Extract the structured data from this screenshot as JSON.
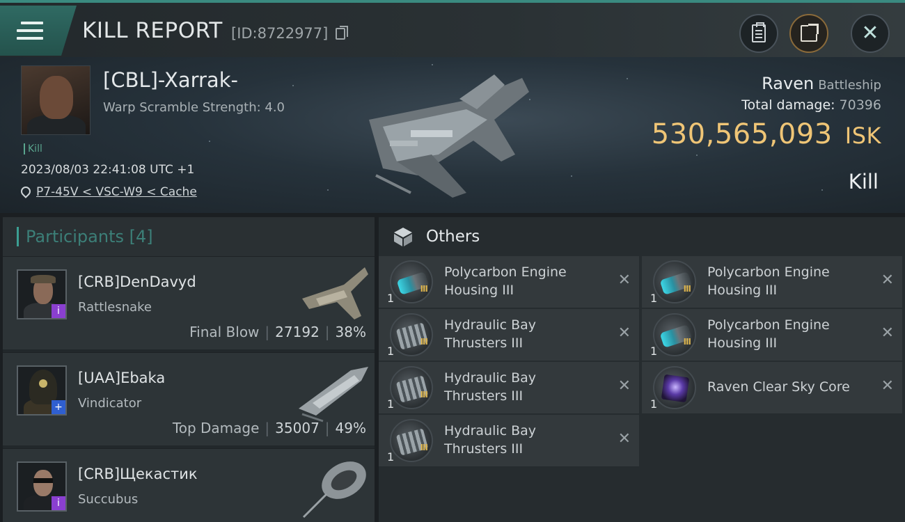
{
  "header": {
    "title": "KILL REPORT",
    "report_id": "[ID:8722977]",
    "icons": [
      "menu-icon",
      "copy-icon",
      "clipboard-icon",
      "share-icon",
      "close-icon"
    ]
  },
  "victim": {
    "name": "[CBL]-Xarrak-",
    "subtitle": "Warp Scramble Strength: 4.0",
    "tag": "Kill",
    "datetime": "2023/08/03 22:41:08 UTC +1",
    "location": "P7-45V < VSC-W9 < Cache",
    "ship_name": "Raven",
    "ship_class": "Battleship",
    "total_damage_label": "Total damage:",
    "total_damage": "70396",
    "isk_value": "530,565,093",
    "isk_unit": "ISK",
    "result": "Kill"
  },
  "participants": {
    "title": "Participants [4]",
    "rows": [
      {
        "name": "[CRB]DenDavyd",
        "ship": "Rattlesnake",
        "role": "Final Blow",
        "damage": "27192",
        "percent": "38%",
        "badge": "i",
        "badge_color": "#8a3fd0"
      },
      {
        "name": "[UAA]Ebaka",
        "ship": "Vindicator",
        "role": "Top Damage",
        "damage": "35007",
        "percent": "49%",
        "badge": "+",
        "badge_color": "#2f5fd0"
      },
      {
        "name": "[CRB]Щекастик",
        "ship": "Succubus",
        "role": "",
        "damage": "",
        "percent": "",
        "badge": "i",
        "badge_color": "#8a3fd0"
      }
    ]
  },
  "others": {
    "title": "Others",
    "items": [
      {
        "line1": "Polycarbon Engine",
        "line2": "Housing III",
        "qty": "1",
        "icon": "engine-housing-icon"
      },
      {
        "line1": "Polycarbon Engine",
        "line2": "Housing III",
        "qty": "1",
        "icon": "engine-housing-icon"
      },
      {
        "line1": "Hydraulic Bay",
        "line2": "Thrusters III",
        "qty": "1",
        "icon": "thrusters-icon"
      },
      {
        "line1": "Polycarbon Engine",
        "line2": "Housing III",
        "qty": "1",
        "icon": "engine-housing-icon"
      },
      {
        "line1": "Hydraulic Bay",
        "line2": "Thrusters III",
        "qty": "1",
        "icon": "thrusters-icon"
      },
      {
        "line1": "Raven Clear Sky Core",
        "line2": "",
        "qty": "1",
        "icon": "clear-sky-core-icon"
      },
      {
        "line1": "Hydraulic Bay",
        "line2": "Thrusters III",
        "qty": "1",
        "icon": "thrusters-icon"
      }
    ],
    "tier_mark": "III",
    "remove_glyph": "✕"
  },
  "colors": {
    "accent": "#3c9f93",
    "isk": "#efc576",
    "background": "#1b1f22"
  }
}
